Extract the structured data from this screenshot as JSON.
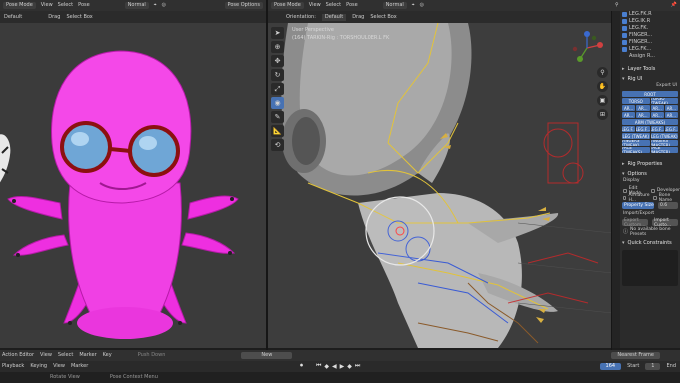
{
  "left_header": {
    "mode": "Pose Mode",
    "menus": [
      "View",
      "Select",
      "Pose"
    ],
    "transform": "Normal",
    "orientation_label": "Default",
    "drag_label": "Drag",
    "drag_value": "Select Box",
    "options": "Pose Options"
  },
  "right_header": {
    "mode": "Pose Mode",
    "menus": [
      "View",
      "Select",
      "Pose"
    ],
    "transform": "Normal",
    "orientation_label": "Orientation:",
    "orientation_value": "Default",
    "drag_label": "Drag",
    "drag_value": "Select Box"
  },
  "viewport": {
    "line1": "User Perspective",
    "line2": "(164) TARKIN-Rig : TORSHOUL0ER.L FK"
  },
  "bone_list": [
    "LEG.FK.R",
    "LEG.IK.R",
    "LEG.FK.",
    "FINGER...",
    "FINGER...",
    "LEG.FK...",
    "Assign R..."
  ],
  "props_sections": {
    "layer_tools": "Layer Tools",
    "rig_ui": "Rig UI",
    "export_label": "Export UI",
    "root": "ROOT",
    "torso_row": [
      "TORSO",
      "TORSO (TWEAK)"
    ],
    "arm_row1": [
      "AR...",
      "AR...",
      "AR...",
      "AR..."
    ],
    "arm_row2": [
      "AR...",
      "AR...",
      "AR...",
      "AR..."
    ],
    "arm_tweaks": "ARM (TWEAKS)",
    "leg_row1": [
      "LEG.F...",
      "LEG.F...",
      "LEG.F...",
      "LEG.F..."
    ],
    "leg_tweaks": [
      "LEG (TWEAK)",
      "LEG (TWEAK)"
    ],
    "fingers": [
      "FINGERS (TWEAK)",
      "FINGERS (MASTER)"
    ],
    "face": [
      "FACE (TWEAKS)",
      "FACE (MASTER)"
    ],
    "rig_properties": "Rig Properties",
    "options": "Options",
    "display": "Display",
    "edit_mode": "Edit Mode",
    "developer": "Developer",
    "armature_h": "Armature H...",
    "bone_name": "Bone Name",
    "property_size": "Property Size",
    "property_size_value": "0.6",
    "import_export": "Import/Export",
    "export_custom": "Export Custom...",
    "import_custom": "Import Custo...",
    "no_presets": "No available bone Presets",
    "quick_constraints": "Quick Constraints"
  },
  "timeline": {
    "editor": "Action Editor",
    "menus": [
      "View",
      "Select",
      "Marker",
      "Key"
    ],
    "new_btn": "New",
    "push_down": "Push Down",
    "playback": "Playback",
    "keying": "Keying",
    "menus2": [
      "View",
      "Marker"
    ],
    "current_frame": "164",
    "start_label": "Start",
    "start_value": "1",
    "end_label": "End",
    "nearest_frame": "Nearest Frame"
  },
  "status": {
    "rotate": "Rotate View",
    "context": "Pose Context Menu"
  }
}
